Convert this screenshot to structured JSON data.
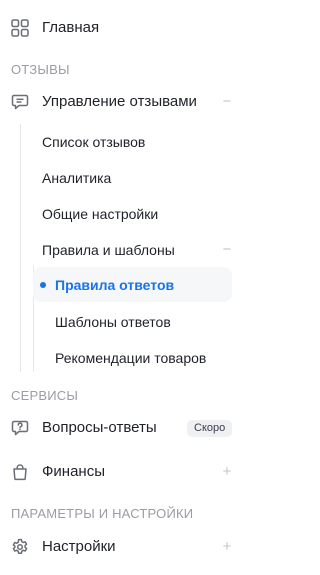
{
  "nav": {
    "home": {
      "label": "Главная",
      "icon": "grid-icon"
    },
    "sections": {
      "reviews": "Отзывы",
      "services": "Сервисы",
      "settings": "Параметры и настройки"
    },
    "review_management": {
      "label": "Управление отзывами",
      "icon": "chat-bubble-icon",
      "expanded": true,
      "toggle": "−",
      "items": [
        {
          "label": "Список отзывов"
        },
        {
          "label": "Аналитика"
        },
        {
          "label": "Общие настройки"
        },
        {
          "label": "Правила и шаблоны",
          "toggle": "−",
          "expanded": true,
          "items": [
            {
              "label": "Правила ответов",
              "active": true
            },
            {
              "label": "Шаблоны ответов"
            },
            {
              "label": "Рекомендации товаров"
            }
          ]
        }
      ]
    },
    "qa": {
      "label": "Вопросы-ответы",
      "icon": "question-bubble-icon",
      "badge": "Скоро"
    },
    "finance": {
      "label": "Финансы",
      "icon": "shopping-bag-icon",
      "toggle": "+"
    },
    "settings": {
      "label": "Настройки",
      "icon": "gear-icon",
      "toggle": "+"
    }
  },
  "colors": {
    "accent": "#1a73e8",
    "section_header": "#9a9ca6",
    "text": "#1f2129",
    "muted_toggle": "#c2c4cc",
    "active_bg": "#f6f7f9"
  }
}
